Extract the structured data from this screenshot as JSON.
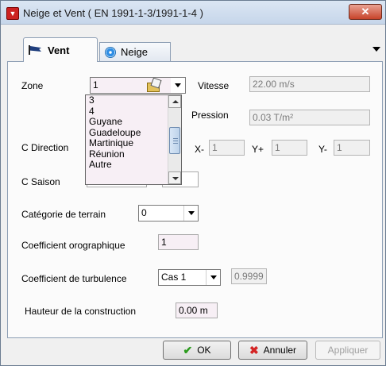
{
  "window": {
    "title": "Neige et Vent ( EN 1991-1-3/1991-1-4 )",
    "close_symbol": "✕"
  },
  "tabs": [
    {
      "label": "Vent",
      "icon": "flag-icon",
      "active": true
    },
    {
      "label": "Neige",
      "icon": "snowflake-icon",
      "active": false
    }
  ],
  "form": {
    "zone_label": "Zone",
    "zone_value": "1",
    "zone_options": [
      "3",
      "4",
      "Guyane",
      "Guadeloupe",
      "Martinique",
      "Réunion",
      "Autre"
    ],
    "vitesse_label": "Vitesse",
    "vitesse_value": "22.00 m/s",
    "pression_label": "Pression",
    "pression_value": "0.03 T/m²",
    "c_direction_label": "C Direction",
    "x_minus_label": "X-",
    "x_minus_value": "1",
    "y_plus_label": "Y+",
    "y_plus_value": "1",
    "y_minus_label": "Y-",
    "y_minus_value": "1",
    "c_saison_label": "C Saison",
    "categorie_label": "Catégorie de terrain",
    "categorie_value": "0",
    "orographique_label": "Coefficient orographique",
    "orographique_value": "1",
    "turbulence_label": "Coefficient de turbulence",
    "turbulence_value": "Cas 1",
    "turbulence_result": "0.9999",
    "hauteur_label": "Hauteur de la construction",
    "hauteur_value": "0.00 m"
  },
  "buttons": {
    "ok_label": "OK",
    "cancel_label": "Annuler",
    "apply_label": "Appliquer"
  }
}
